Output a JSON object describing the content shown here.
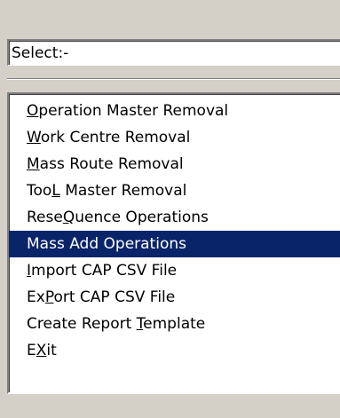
{
  "select": {
    "value": "Select:-"
  },
  "list": {
    "selected_index": 5,
    "items": [
      {
        "pre": "",
        "key": "O",
        "post": "peration Master Removal"
      },
      {
        "pre": "",
        "key": "W",
        "post": "ork Centre Removal"
      },
      {
        "pre": "",
        "key": "M",
        "post": "ass Route Removal"
      },
      {
        "pre": "Too",
        "key": "L",
        "post": " Master Removal"
      },
      {
        "pre": "Rese",
        "key": "Q",
        "post": "uence Operations"
      },
      {
        "pre": "Mass Add Operations",
        "key": "",
        "post": ""
      },
      {
        "pre": "",
        "key": "I",
        "post": "mport CAP CSV File"
      },
      {
        "pre": "Ex",
        "key": "P",
        "post": "ort CAP CSV File"
      },
      {
        "pre": "Create Report ",
        "key": "T",
        "post": "emplate"
      },
      {
        "pre": "E",
        "key": "X",
        "post": "it"
      }
    ]
  },
  "colors": {
    "window_bg": "#d4d0c8",
    "selection_bg": "#0a246a",
    "selection_fg": "#ffffff"
  }
}
